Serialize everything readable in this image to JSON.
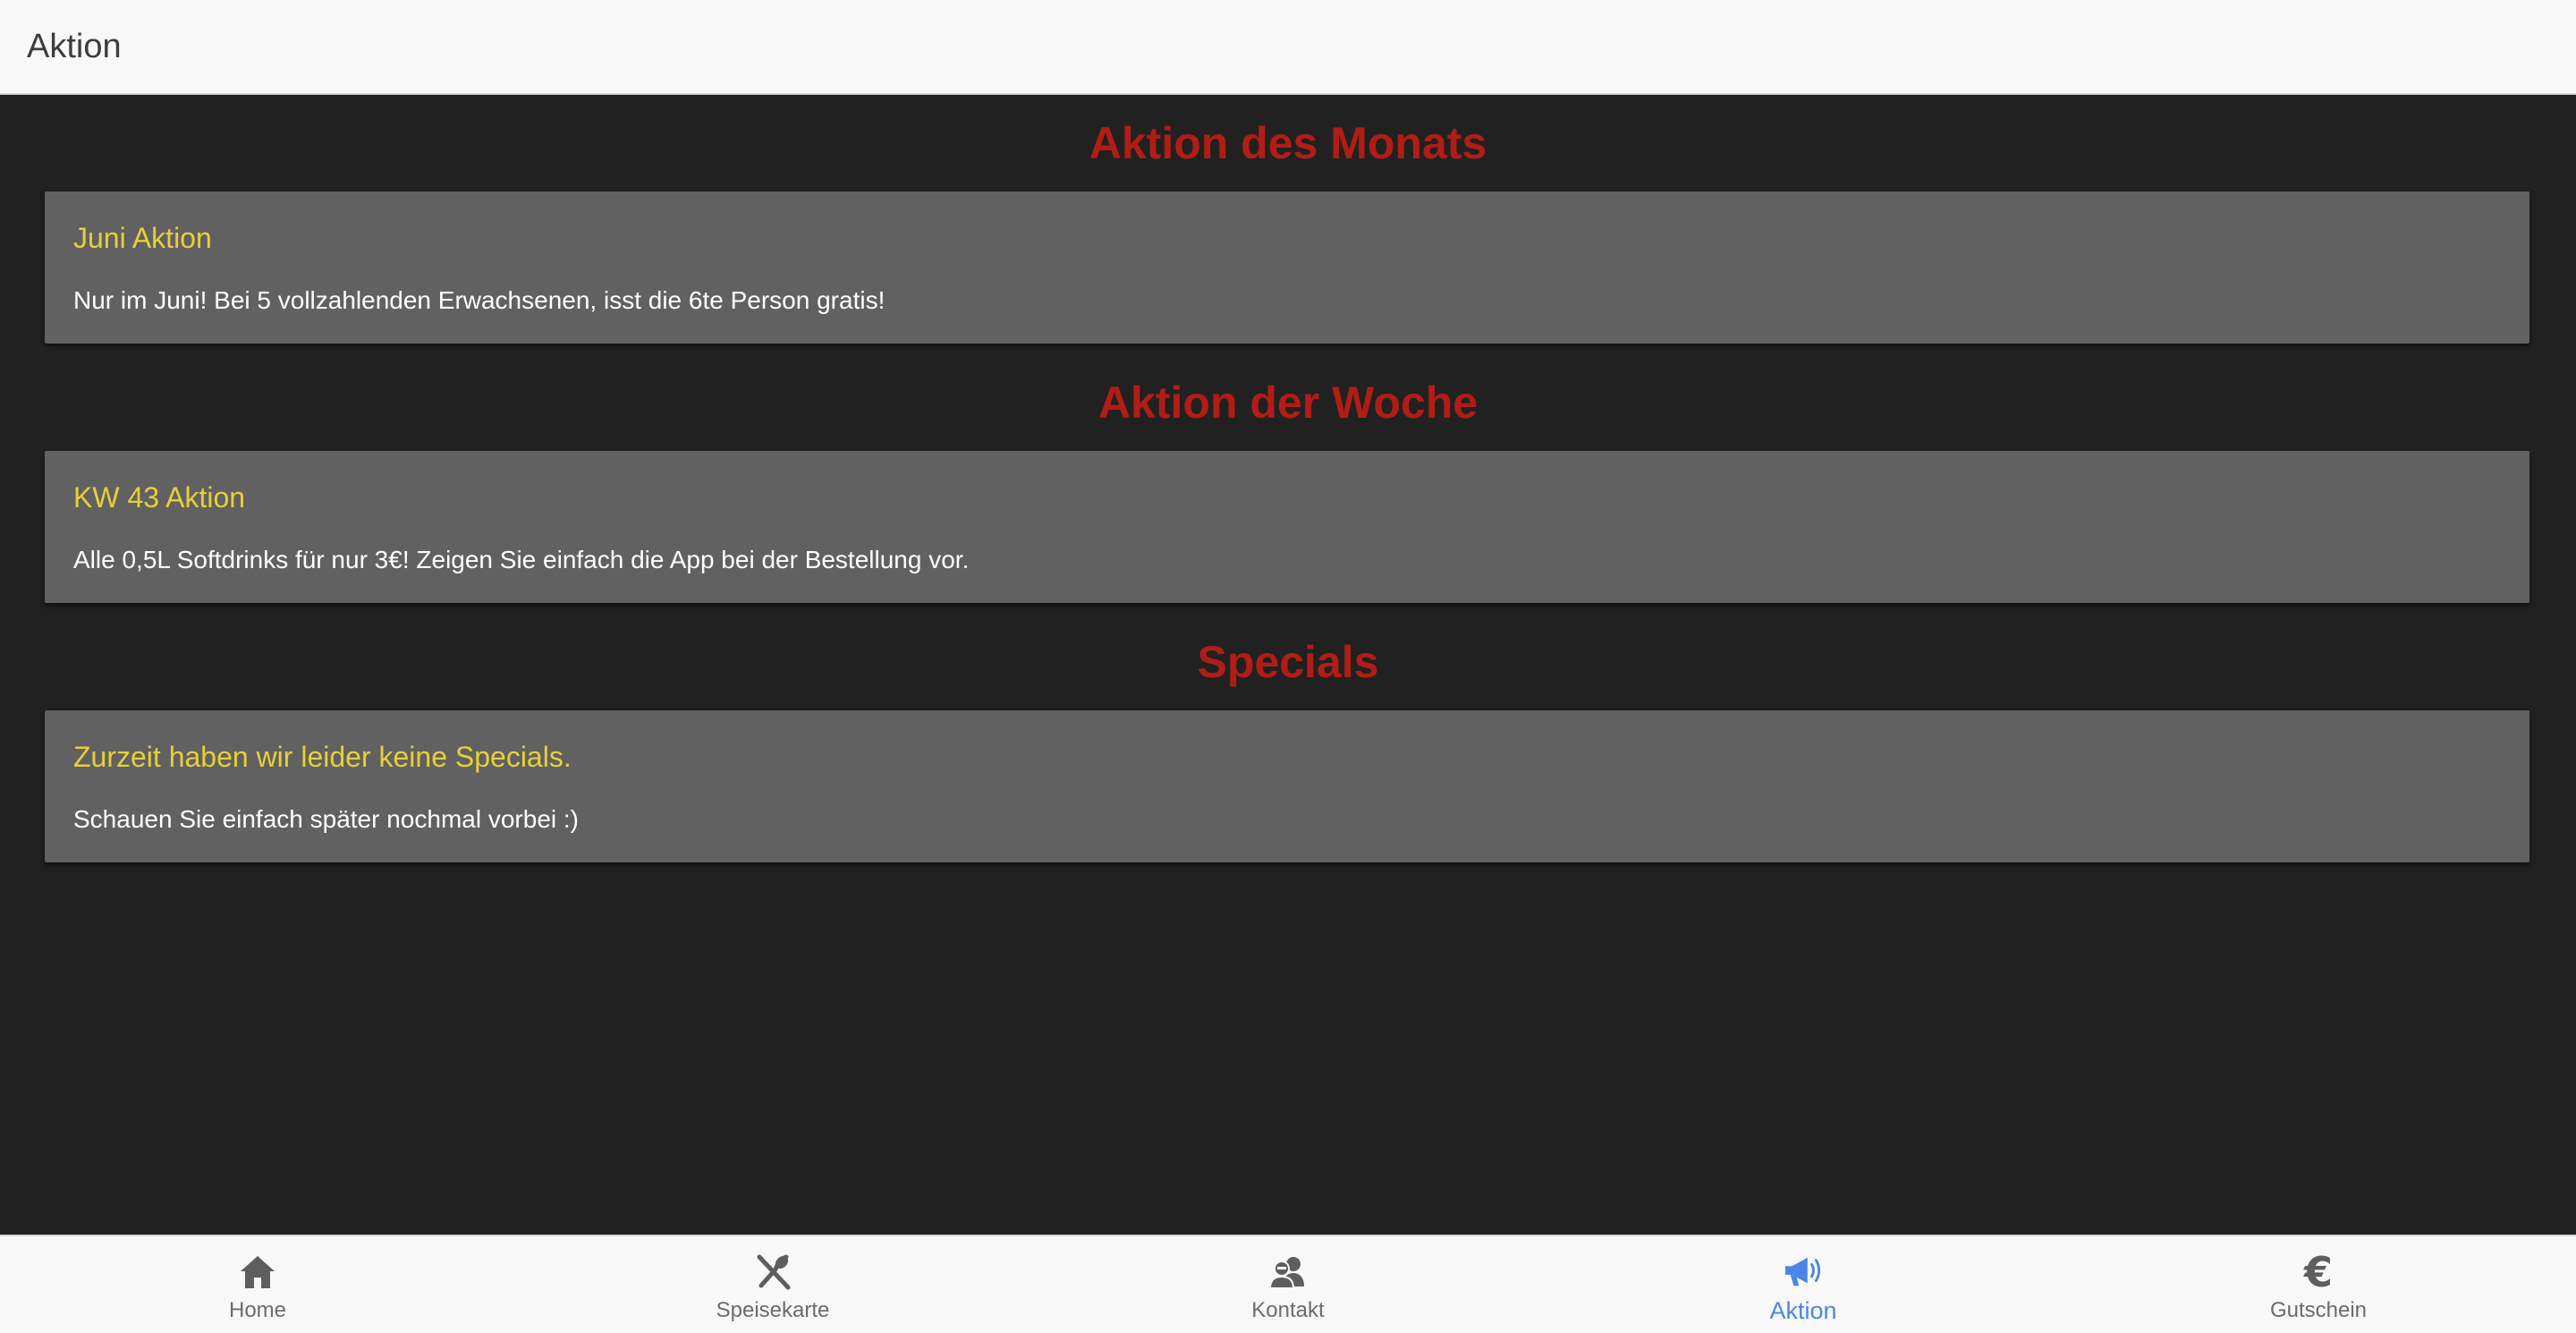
{
  "header": {
    "title": "Aktion"
  },
  "sections": [
    {
      "heading": "Aktion des Monats",
      "card": {
        "title": "Juni Aktion",
        "text": "Nur im Juni! Bei 5 vollzahlenden Erwachsenen, isst die 6te Person gratis!"
      }
    },
    {
      "heading": "Aktion der Woche",
      "card": {
        "title": "KW 43 Aktion",
        "text": "Alle 0,5L Softdrinks für nur 3€! Zeigen Sie einfach die App bei der Bestellung vor."
      }
    },
    {
      "heading": "Specials",
      "card": {
        "title": "Zurzeit haben wir leider keine Specials.",
        "text": "Schauen Sie einfach später nochmal vorbei :)"
      }
    }
  ],
  "tabs": [
    {
      "label": "Home",
      "icon": "home-icon",
      "active": false
    },
    {
      "label": "Speisekarte",
      "icon": "fork-knife-icon",
      "active": false
    },
    {
      "label": "Kontakt",
      "icon": "people-icon",
      "active": false
    },
    {
      "label": "Aktion",
      "icon": "megaphone-icon",
      "active": true
    },
    {
      "label": "Gutschein",
      "icon": "euro-icon",
      "active": false,
      "glyph": "€"
    }
  ],
  "colors": {
    "heading": "#b11d15",
    "card_title": "#e6d038",
    "card_bg": "#616161",
    "page_bg": "#212121",
    "active_tab": "#4a86e8",
    "inactive_tab": "#5e5e5e"
  }
}
